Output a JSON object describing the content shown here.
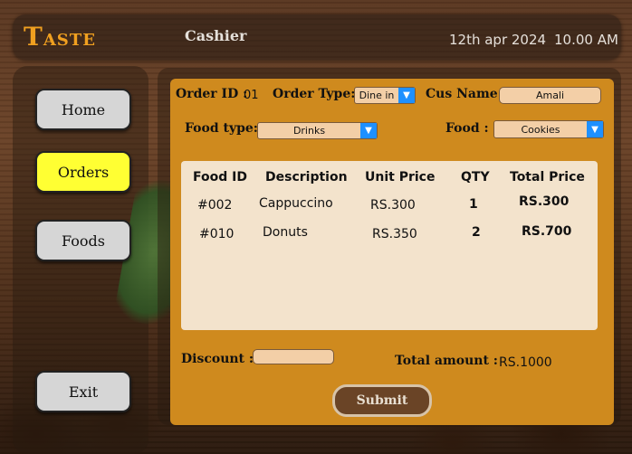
{
  "header": {
    "logo_first": "T",
    "logo_rest": "ASTE",
    "role": "Cashier",
    "date": "12th apr 2024",
    "time": "10.00 AM"
  },
  "sidebar": {
    "items": [
      {
        "label": "Home",
        "active": false
      },
      {
        "label": "Orders",
        "active": true
      },
      {
        "label": "Foods",
        "active": false
      },
      {
        "label": "Exit",
        "active": false
      }
    ]
  },
  "order": {
    "id_label": "Order ID :",
    "id_value": "01",
    "type_label": "Order Type:",
    "type_value": "Dine in",
    "customer_label": "Cus Name :",
    "customer_value": "Amali",
    "food_type_label": "Food type:",
    "food_type_value": "Drinks",
    "food_label": "Food :",
    "food_value": "Cookies"
  },
  "table": {
    "headers": [
      "Food ID",
      "Description",
      "Unit Price",
      "QTY",
      "Total Price"
    ],
    "rows": [
      [
        "#002",
        "Cappuccino",
        "RS.300",
        "1",
        "RS.300"
      ],
      [
        "#010",
        "Donuts",
        "RS.350",
        "2",
        "RS.700"
      ]
    ]
  },
  "footer": {
    "discount_label": "Discount :",
    "discount_value": "",
    "total_label": "Total amount :",
    "total_value": "RS.1000",
    "submit_label": "Submit"
  },
  "colors": {
    "accent": "#f0a020",
    "form_bg": "#cf8a1e",
    "active_nav": "#ffff33",
    "dropdown_arrow": "#1e90ff"
  }
}
